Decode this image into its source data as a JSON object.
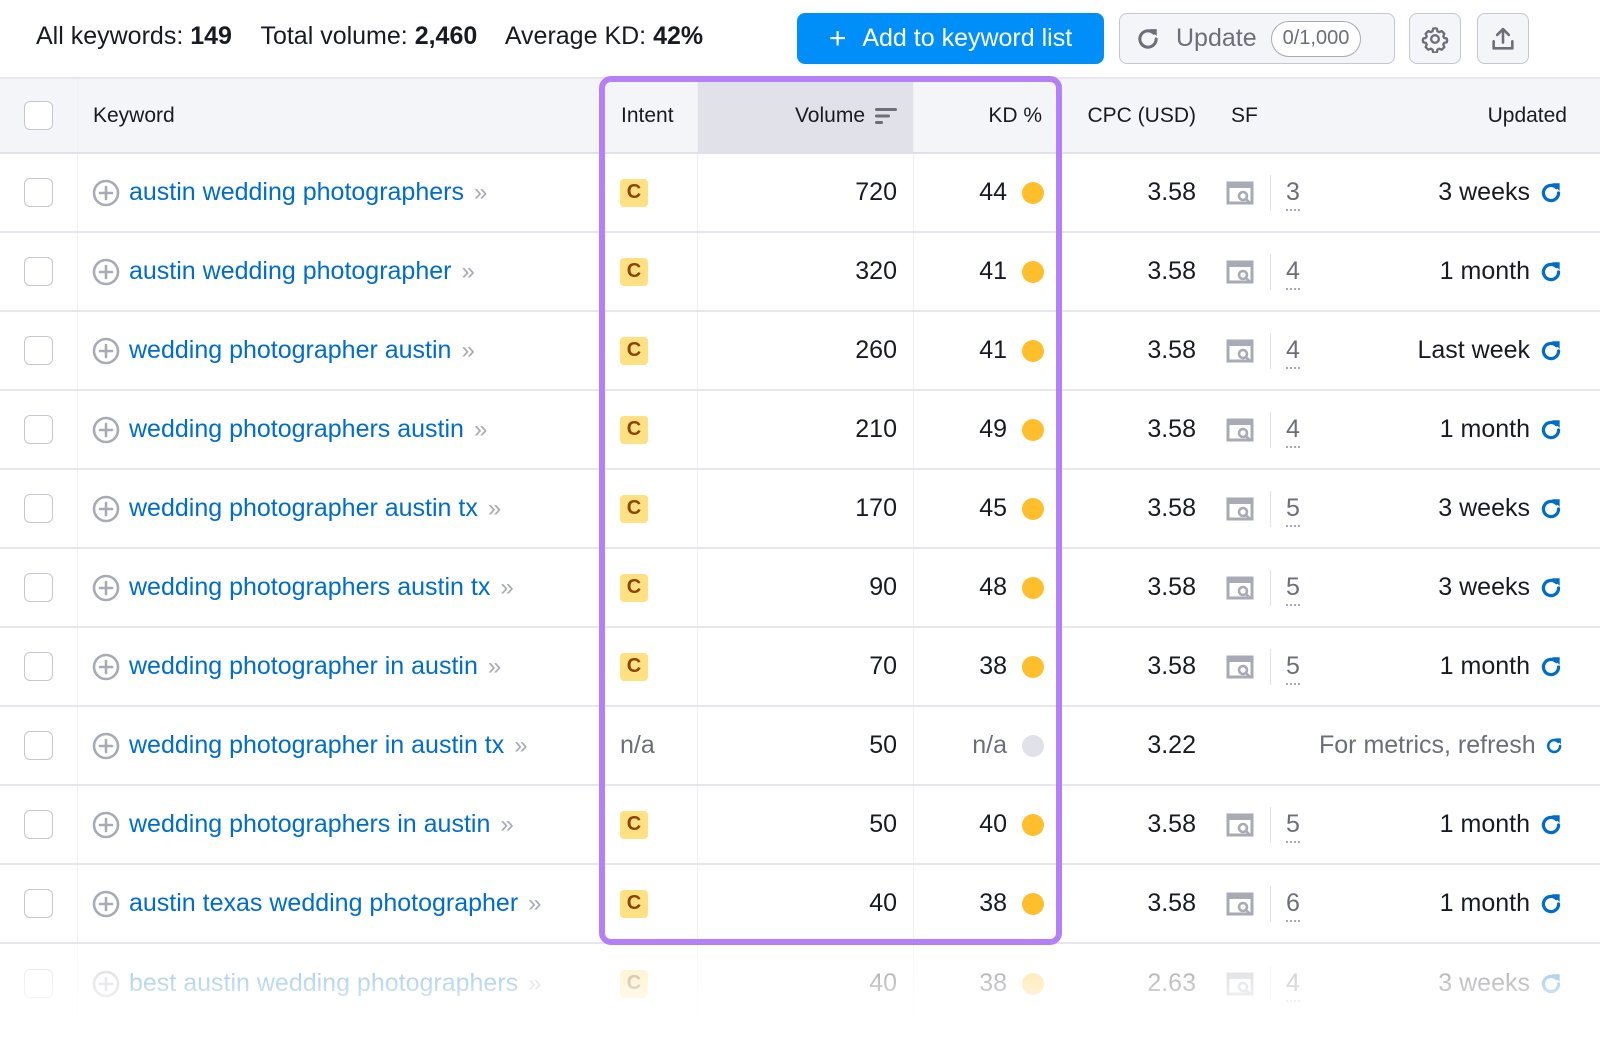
{
  "summary": {
    "all_keywords_label": "All keywords:",
    "all_keywords_value": "149",
    "total_volume_label": "Total volume:",
    "total_volume_value": "2,460",
    "average_kd_label": "Average KD:",
    "average_kd_value": "42%"
  },
  "toolbar": {
    "add_label": "Add to keyword list",
    "update_label": "Update",
    "update_quota": "0/1,000",
    "settings_icon": "gear-icon",
    "export_icon": "upload-icon"
  },
  "table": {
    "headers": {
      "keyword": "Keyword",
      "intent": "Intent",
      "volume": "Volume",
      "kd": "KD %",
      "cpc": "CPC (USD)",
      "sf": "SF",
      "updated": "Updated"
    },
    "sorted_by": "Volume",
    "rows": [
      {
        "keyword": "austin wedding photographers",
        "intent": "C",
        "volume": "720",
        "kd": "44",
        "kd_level": "medium",
        "cpc": "3.58",
        "sf": "3",
        "updated": "3 weeks"
      },
      {
        "keyword": "austin wedding photographer",
        "intent": "C",
        "volume": "320",
        "kd": "41",
        "kd_level": "medium",
        "cpc": "3.58",
        "sf": "4",
        "updated": "1 month"
      },
      {
        "keyword": "wedding photographer austin",
        "intent": "C",
        "volume": "260",
        "kd": "41",
        "kd_level": "medium",
        "cpc": "3.58",
        "sf": "4",
        "updated": "Last week"
      },
      {
        "keyword": "wedding photographers austin",
        "intent": "C",
        "volume": "210",
        "kd": "49",
        "kd_level": "medium",
        "cpc": "3.58",
        "sf": "4",
        "updated": "1 month"
      },
      {
        "keyword": "wedding photographer austin tx",
        "intent": "C",
        "volume": "170",
        "kd": "45",
        "kd_level": "medium",
        "cpc": "3.58",
        "sf": "5",
        "updated": "3 weeks"
      },
      {
        "keyword": "wedding photographers austin tx",
        "intent": "C",
        "volume": "90",
        "kd": "48",
        "kd_level": "medium",
        "cpc": "3.58",
        "sf": "5",
        "updated": "3 weeks"
      },
      {
        "keyword": "wedding photographer in austin",
        "intent": "C",
        "volume": "70",
        "kd": "38",
        "kd_level": "medium",
        "cpc": "3.58",
        "sf": "5",
        "updated": "1 month"
      },
      {
        "keyword": "wedding photographer in austin tx",
        "intent": "n/a",
        "volume": "50",
        "kd": "n/a",
        "kd_level": "none",
        "cpc": "3.22",
        "sf": "",
        "updated": "For metrics, refresh"
      },
      {
        "keyword": "wedding photographers in austin",
        "intent": "C",
        "volume": "50",
        "kd": "40",
        "kd_level": "medium",
        "cpc": "3.58",
        "sf": "5",
        "updated": "1 month"
      },
      {
        "keyword": "austin texas wedding photographer",
        "intent": "C",
        "volume": "40",
        "kd": "38",
        "kd_level": "medium",
        "cpc": "3.58",
        "sf": "6",
        "updated": "1 month"
      },
      {
        "keyword": "best austin wedding photographers",
        "intent": "C",
        "volume": "40",
        "kd": "38",
        "kd_level": "medium",
        "cpc": "2.63",
        "sf": "4",
        "updated": "3 weeks"
      }
    ]
  },
  "colors": {
    "primary_button": "#008ff8",
    "link": "#006dca",
    "intent_commercial_bg": "#ffe083",
    "intent_commercial_text": "#8c4400",
    "kd_medium": "#ffbf2d",
    "kd_none": "#e0e1e9",
    "highlight_border": "#b57ff8",
    "refresh_icon": "#006dca"
  }
}
